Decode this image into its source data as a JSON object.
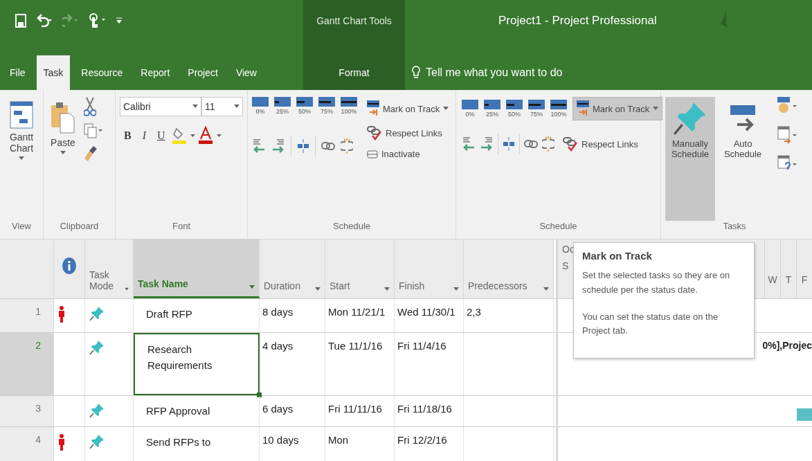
{
  "title_bar": {
    "context_label": "Gantt Chart Tools",
    "title": "Project1  -  Project Professional"
  },
  "tabs": [
    {
      "label": "File",
      "selected": false
    },
    {
      "label": "Task",
      "selected": true
    },
    {
      "label": "Resource",
      "selected": false
    },
    {
      "label": "Report",
      "selected": false
    },
    {
      "label": "Project",
      "selected": false
    },
    {
      "label": "View",
      "selected": false
    }
  ],
  "context_tab": {
    "label": "Format",
    "selected": false
  },
  "tell_me": {
    "placeholder": "Tell me what you want to do"
  },
  "ribbon": {
    "view": {
      "label": "View",
      "gantt_chart": "Gantt Chart"
    },
    "clipboard": {
      "label": "Clipboard",
      "paste": "Paste"
    },
    "font": {
      "label": "Font",
      "font_name": "Calibri",
      "font_size": "11",
      "bold": "B",
      "italic": "I",
      "underline": "U"
    },
    "schedule_1": {
      "label": "Schedule",
      "percents": [
        "0%",
        "25%",
        "50%",
        "75%",
        "100%"
      ],
      "mark_on_track": {
        "label": "Mark on Track",
        "highlighted": false
      },
      "respect_links": "Respect Links",
      "inactivate": "Inactivate"
    },
    "schedule_2": {
      "label": "Schedule",
      "percents": [
        "0%",
        "25%",
        "50%",
        "75%",
        "100%"
      ],
      "mark_on_track": {
        "label": "Mark on Track",
        "highlighted": true
      },
      "respect_links": "Respect Links"
    },
    "tasks": {
      "label": "Tasks",
      "modes": [
        {
          "label": "Manually Schedule",
          "kind": "manual",
          "selected": true
        },
        {
          "label": "Auto Schedule",
          "kind": "auto",
          "selected": false
        }
      ]
    }
  },
  "table": {
    "columns": [
      {
        "kind": "info"
      },
      {
        "label": "Task Mode",
        "kind": "text"
      },
      {
        "label": "Task Name",
        "kind": "text",
        "selected": true
      },
      {
        "label": "Duration",
        "kind": "text"
      },
      {
        "label": "Start",
        "kind": "text"
      },
      {
        "label": "Finish",
        "kind": "text"
      },
      {
        "label": "Predecessors",
        "kind": "text"
      }
    ],
    "rows": [
      {
        "id": "1",
        "indicator": true,
        "selected": false,
        "name": "Draft RFP",
        "duration": "8 days",
        "start": "Mon 11/21/1",
        "finish": "Wed 11/30/1",
        "predecessors": "2,3"
      },
      {
        "id": "2",
        "indicator": false,
        "selected": true,
        "name": "Research Requirements",
        "duration": "4 days",
        "start": "Tue 11/1/16",
        "finish": "Fri 11/4/16",
        "predecessors": ""
      },
      {
        "id": "3",
        "indicator": false,
        "selected": false,
        "name": "RFP Approval",
        "duration": "6 days",
        "start": "Fri 11/11/16",
        "finish": "Fri 11/18/16",
        "predecessors": ""
      },
      {
        "id": "4",
        "indicator": true,
        "selected": false,
        "name": "Send RFPs to",
        "duration": "10 days",
        "start": "Mon",
        "finish": "Fri 12/2/16",
        "predecessors": ""
      }
    ]
  },
  "gantt": {
    "month": "Oc",
    "day": "S",
    "days": [
      "W",
      "T",
      "F"
    ],
    "bar_label": "0%],Projec"
  },
  "tooltip": {
    "title": "Mark on Track",
    "paragraphs": [
      "Set the selected tasks so they are on schedule per the status date.",
      "You can set the status date on the Project tab."
    ]
  }
}
